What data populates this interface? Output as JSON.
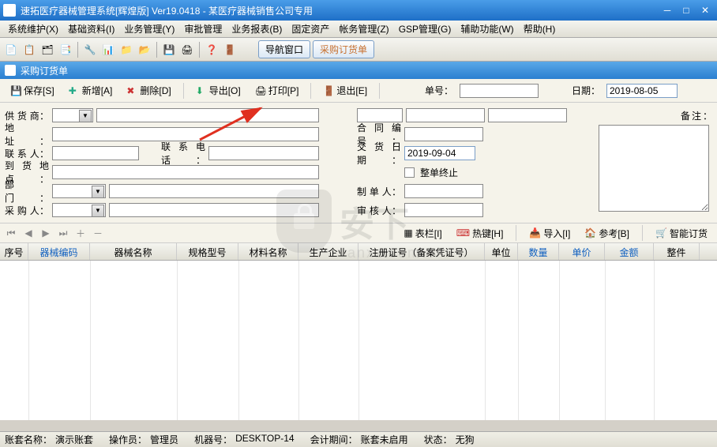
{
  "title": "速拓医疗器械管理系统[辉煌版] Ver19.0418  -  某医疗器械销售公司专用",
  "menu": [
    "系统维护(X)",
    "基础资料(I)",
    "业务管理(Y)",
    "审批管理",
    "业务报表(B)",
    "固定资产",
    "帐务管理(Z)",
    "GSP管理(G)",
    "辅助功能(W)",
    "帮助(H)"
  ],
  "toolbar_buttons": {
    "nav_window": "导航窗口",
    "purchase_order": "采购订货单"
  },
  "subtitle": "采购订货单",
  "actions": {
    "save": "保存[S]",
    "new": "新增[A]",
    "delete": "删除[D]",
    "export": "导出[O]",
    "print": "打印[P]",
    "exit": "退出[E]",
    "order_no_label": "单号",
    "date_label": "日期",
    "date_value": "2019-08-05"
  },
  "form": {
    "supplier": "供 货 商",
    "address": "地　　址",
    "contact": "联 系 人",
    "phone": "联系电话",
    "arrival": "到货地点",
    "dept": "部　　门",
    "buyer": "采 购 人",
    "contract_no": "合同编号",
    "delivery_date": "交货日期",
    "delivery_value": "2019-09-04",
    "whole_end": "整单终止",
    "maker": "制 单 人",
    "reviewer": "审 核 人",
    "remark": "备注"
  },
  "mid_actions": {
    "table": "表栏[I]",
    "hotkey": "热键[H]",
    "import": "导入[I]",
    "reference": "参考[B]",
    "smart": "智能订货"
  },
  "grid_headers": [
    "序号",
    "器械编码",
    "器械名称",
    "规格型号",
    "材料名称",
    "生产企业",
    "注册证号（备案凭证号）",
    "单位",
    "数量",
    "单价",
    "金额",
    "整件"
  ],
  "status": {
    "account_name_label": "账套名称：",
    "account_name": "演示账套",
    "operator_label": "操作员：",
    "operator": "管理员",
    "machine_label": "机器号：",
    "machine": "DESKTOP-14",
    "period_label": "会计期间：",
    "period": "账套未启用",
    "state_label": "状态：",
    "state": "无狗"
  },
  "watermark": {
    "text": "安下",
    "sub": "anxz.com"
  }
}
